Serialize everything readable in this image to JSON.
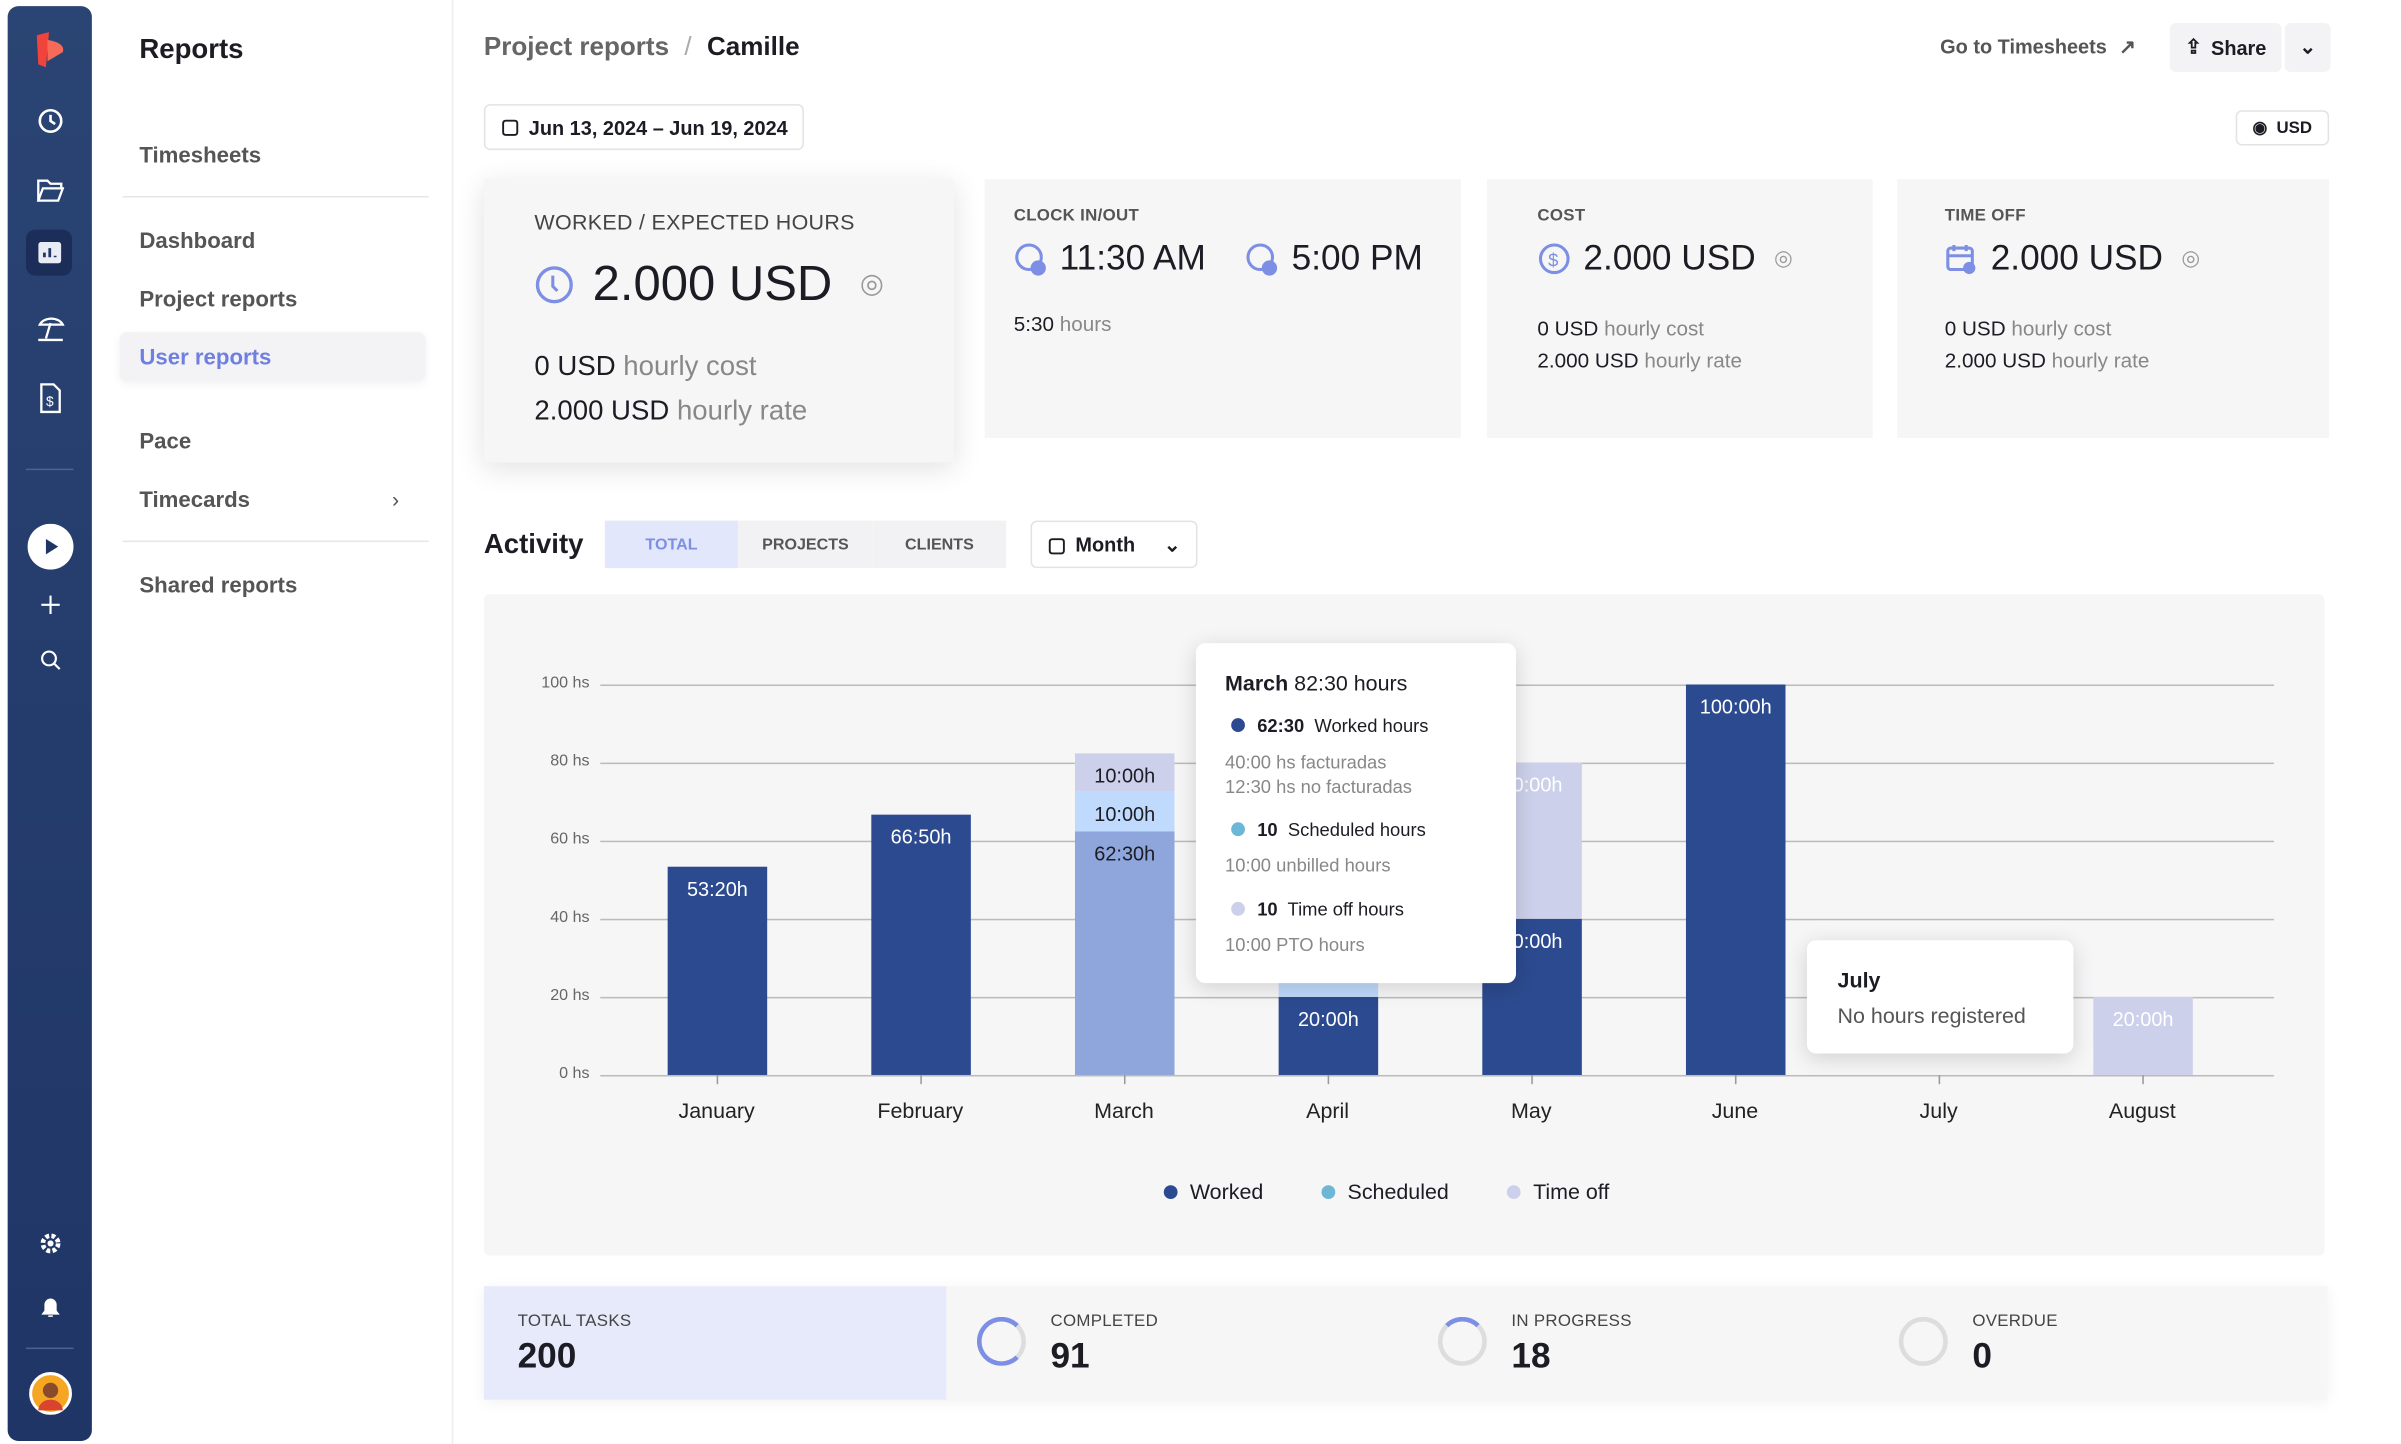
{
  "nav": {
    "title": "Reports",
    "items": [
      {
        "label": "Timesheets"
      },
      {
        "label": "Dashboard"
      },
      {
        "label": "Project reports"
      },
      {
        "label": "User reports",
        "active": true
      },
      {
        "label": "Pace"
      },
      {
        "label": "Timecards"
      },
      {
        "label": "Shared reports"
      }
    ]
  },
  "rail": {
    "icons": [
      "logo",
      "clock-icon",
      "folder-icon",
      "chart-icon",
      "beach-umbrella-icon",
      "invoice-icon",
      "play-icon",
      "plus-icon",
      "search-icon",
      "gear-icon",
      "bell-icon",
      "avatar"
    ]
  },
  "header": {
    "breadcrumb_parent": "Project reports",
    "breadcrumb_sep": "/",
    "breadcrumb_current": "Camille",
    "go_timesheets": "Go to Timesheets",
    "share": "Share",
    "date_range": "Jun 13, 2024 – Jun 19, 2024",
    "currency": "USD"
  },
  "cards": {
    "worked": {
      "label": "WORKED / EXPECTED HOURS",
      "value": "2.000 USD",
      "cost_value": "0 USD",
      "cost_label": "hourly cost",
      "rate_value": "2.000 USD",
      "rate_label": "hourly rate"
    },
    "clock": {
      "label": "CLOCK IN/OUT",
      "in": "11:30 AM",
      "out": "5:00 PM",
      "duration": "5:30",
      "duration_label": "hours"
    },
    "cost": {
      "label": "COST",
      "value": "2.000 USD",
      "cost_value": "0 USD",
      "cost_label": "hourly cost",
      "rate_value": "2.000 USD",
      "rate_label": "hourly rate"
    },
    "timeoff": {
      "label": "TIME OFF",
      "value": "2.000 USD",
      "cost_value": "0 USD",
      "cost_label": "hourly cost",
      "rate_value": "2.000 USD",
      "rate_label": "hourly rate"
    }
  },
  "activity": {
    "title": "Activity",
    "tabs": [
      "TOTAL",
      "PROJECTS",
      "CLIENTS"
    ],
    "active_tab": "TOTAL",
    "period": "Month"
  },
  "chart_data": {
    "type": "bar",
    "stacked": true,
    "categories": [
      "January",
      "February",
      "March",
      "April",
      "May",
      "June",
      "July",
      "August"
    ],
    "y_ticks": [
      "0 hs",
      "20 hs",
      "40 hs",
      "60 hs",
      "80 hs",
      "100 hs"
    ],
    "ylim": [
      0,
      100
    ],
    "grid": true,
    "legend_position": "bottom",
    "series": [
      {
        "name": "Worked",
        "color": "#2c4a8f",
        "values": [
          53.33,
          66.83,
          62.5,
          20,
          40,
          100,
          0,
          0
        ],
        "labels": [
          "53:20h",
          "66:50h",
          "62:30h",
          "20:00h",
          "40:00h",
          "100:00h",
          "",
          ""
        ]
      },
      {
        "name": "Scheduled",
        "color": "#bfdafc",
        "legend_color": "#6cb6d6",
        "values": [
          0,
          0,
          10,
          5,
          0,
          0,
          0,
          0
        ],
        "labels": [
          "",
          "",
          "10:00h",
          "",
          "",
          "",
          "",
          ""
        ]
      },
      {
        "name": "Time off",
        "color": "#cdd0ea",
        "values": [
          0,
          0,
          10,
          0,
          40,
          0,
          0,
          20
        ],
        "labels": [
          "",
          "",
          "10:00h",
          "",
          "40:00h",
          "",
          "",
          "20:00h"
        ]
      }
    ],
    "highlight_color": "#8ea6db",
    "tooltip": {
      "title_bold": "March",
      "title_rest": "82:30 hours",
      "rows": [
        {
          "value": "62:30",
          "label": "Worked hours",
          "color": "#2c4a8f",
          "notes": [
            "40:00 hs facturadas",
            "12:30 hs no facturadas"
          ]
        },
        {
          "value": "10",
          "label": "Scheduled hours",
          "color": "#6cb6d6",
          "notes": [
            "10:00 unbilled hours"
          ]
        },
        {
          "value": "10",
          "label": "Time off hours",
          "color": "#cdd0ea",
          "notes": [
            "10:00 PTO hours"
          ]
        }
      ]
    },
    "tooltip_july": {
      "title": "July",
      "text": "No hours registered"
    }
  },
  "tasks": {
    "total_label": "TOTAL TASKS",
    "total": "200",
    "completed_label": "COMPLETED",
    "completed": "91",
    "progress_label": "IN PROGRESS",
    "progress": "18",
    "overdue_label": "OVERDUE",
    "overdue": "0"
  }
}
